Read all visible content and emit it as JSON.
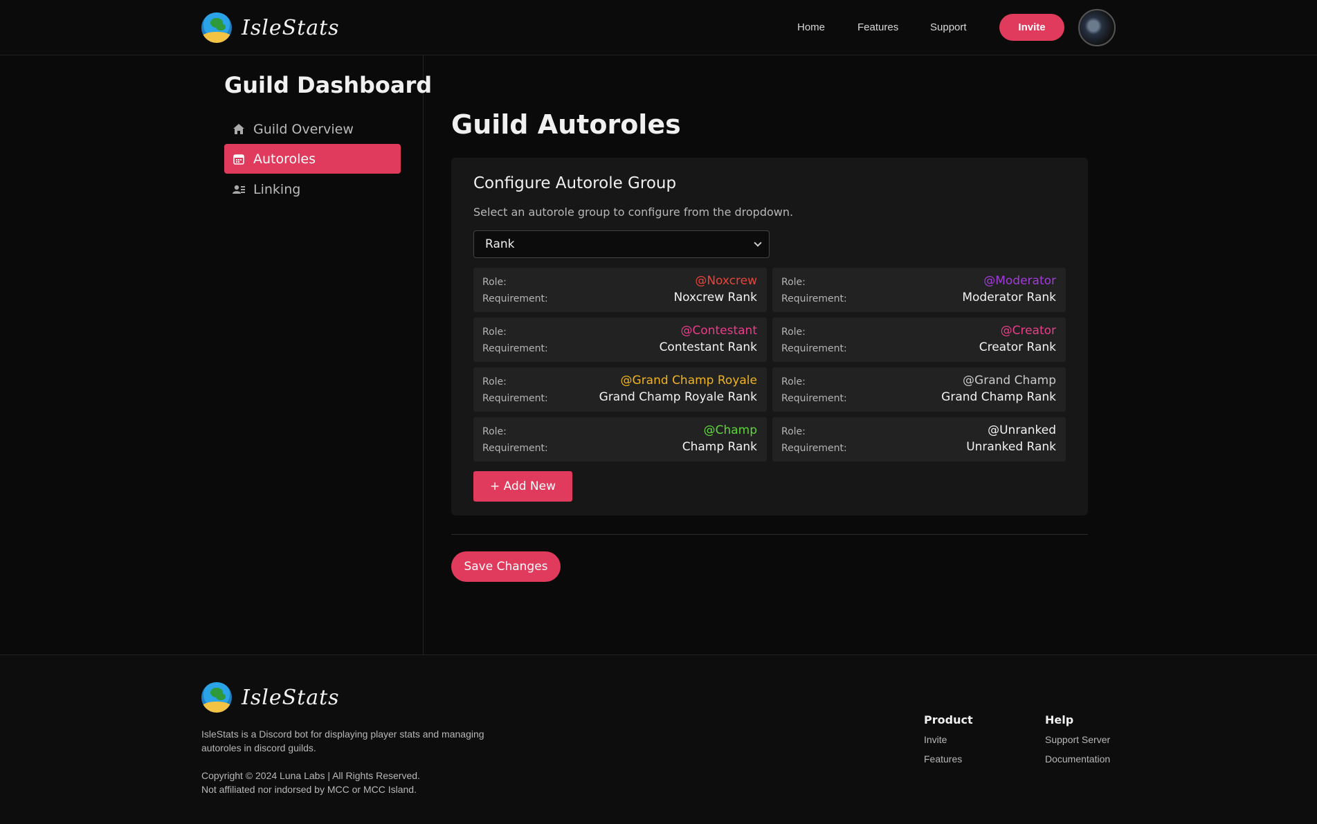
{
  "header": {
    "brand": "IsleStats",
    "nav": [
      "Home",
      "Features",
      "Support"
    ],
    "invite_label": "Invite"
  },
  "sidebar": {
    "title": "Guild Dashboard",
    "items": [
      {
        "label": "Guild Overview",
        "icon": "home-icon",
        "active": false
      },
      {
        "label": "Autoroles",
        "icon": "calendar-icon",
        "active": true
      },
      {
        "label": "Linking",
        "icon": "users-icon",
        "active": false
      }
    ]
  },
  "main": {
    "title": "Guild Autoroles",
    "panel": {
      "title": "Configure Autorole Group",
      "description": "Select an autorole group to configure from the dropdown.",
      "selected_group": "Rank",
      "role_key": "Role:",
      "requirement_key": "Requirement:",
      "roles": [
        {
          "role": "@Noxcrew",
          "requirement": "Noxcrew Rank",
          "color": "#e8443a"
        },
        {
          "role": "@Moderator",
          "requirement": "Moderator Rank",
          "color": "#a23bdb"
        },
        {
          "role": "@Contestant",
          "requirement": "Contestant Rank",
          "color": "#e83e8a"
        },
        {
          "role": "@Creator",
          "requirement": "Creator Rank",
          "color": "#e83e8a"
        },
        {
          "role": "@Grand Champ Royale",
          "requirement": "Grand Champ Royale Rank",
          "color": "#f1b41c"
        },
        {
          "role": "@Grand Champ",
          "requirement": "Grand Champ Rank",
          "color": "#c9c9c9"
        },
        {
          "role": "@Champ",
          "requirement": "Champ Rank",
          "color": "#5fd63a"
        },
        {
          "role": "@Unranked",
          "requirement": "Unranked Rank",
          "color": "#f2f2f2"
        }
      ],
      "add_label": "+ Add New"
    },
    "save_label": "Save Changes"
  },
  "footer": {
    "brand": "IsleStats",
    "description": "IsleStats is a Discord bot for displaying player stats and managing autoroles in discord guilds.",
    "copyright": "Copyright © 2024 Luna Labs | All Rights Reserved.",
    "disclaimer": "Not affiliated nor indorsed by MCC or MCC Island.",
    "product": {
      "heading": "Product",
      "links": [
        "Invite",
        "Features"
      ]
    },
    "help": {
      "heading": "Help",
      "links": [
        "Support Server",
        "Documentation"
      ]
    }
  }
}
